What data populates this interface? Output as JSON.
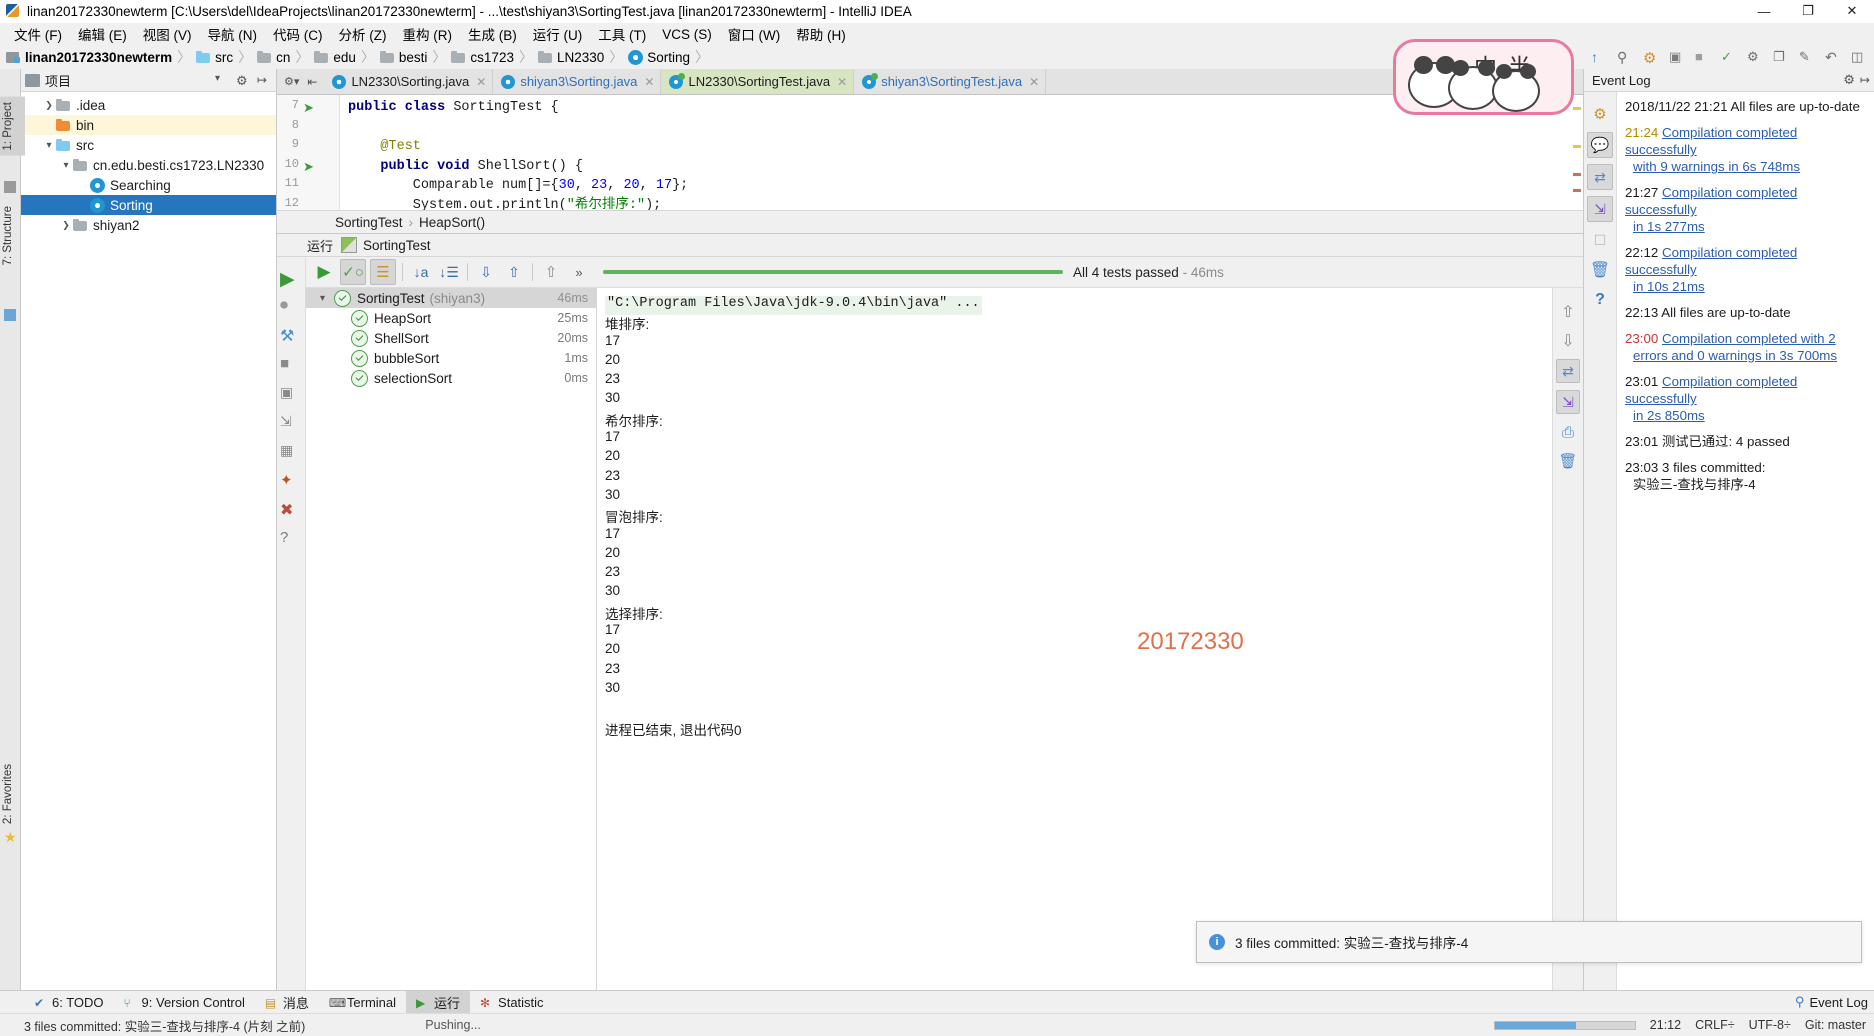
{
  "window": {
    "title": "linan20172330newterm [C:\\Users\\del\\IdeaProjects\\linan20172330newterm] - ...\\test\\shiyan3\\SortingTest.java [linan20172330newterm] - IntelliJ IDEA",
    "minimize": "—",
    "maximize": "❐",
    "close": "✕"
  },
  "menu": [
    {
      "label": "文件 (F)"
    },
    {
      "label": "编辑 (E)"
    },
    {
      "label": "视图 (V)"
    },
    {
      "label": "导航 (N)"
    },
    {
      "label": "代码 (C)"
    },
    {
      "label": "分析 (Z)"
    },
    {
      "label": "重构 (R)"
    },
    {
      "label": "生成 (B)"
    },
    {
      "label": "运行 (U)"
    },
    {
      "label": "工具 (T)"
    },
    {
      "label": "VCS (S)"
    },
    {
      "label": "窗口 (W)"
    },
    {
      "label": "帮助 (H)"
    }
  ],
  "breadcrumb": [
    {
      "label": "linan20172330newterm",
      "icon": "project-icon"
    },
    {
      "label": "src",
      "icon": "folder-blue-icon"
    },
    {
      "label": "cn",
      "icon": "folder-icon"
    },
    {
      "label": "edu",
      "icon": "folder-icon"
    },
    {
      "label": "besti",
      "icon": "folder-icon"
    },
    {
      "label": "cs1723",
      "icon": "folder-icon"
    },
    {
      "label": "LN2330",
      "icon": "folder-icon"
    },
    {
      "label": "Sorting",
      "icon": "class-icon"
    }
  ],
  "panda": {
    "char1": "中",
    "char2": "半"
  },
  "left_rail": [
    {
      "label": "1: Project",
      "selected": true
    },
    {
      "label": "7: Structure",
      "selected": false
    },
    {
      "label": "2: Favorites",
      "selected": false
    }
  ],
  "project_panel": {
    "title": "项目",
    "tree": [
      {
        "label": ".idea",
        "icon": "folder-icon",
        "arrow": "right",
        "indent": 1,
        "state": "normal"
      },
      {
        "label": "bin",
        "icon": "folder-orange-icon",
        "arrow": "none",
        "indent": 1,
        "state": "highlight"
      },
      {
        "label": "src",
        "icon": "folder-blue-icon",
        "arrow": "down",
        "indent": 1,
        "state": "normal"
      },
      {
        "label": "cn.edu.besti.cs1723.LN2330",
        "icon": "folder-icon",
        "arrow": "down",
        "indent": 2,
        "state": "normal"
      },
      {
        "label": "Searching",
        "icon": "class-icon",
        "arrow": "none",
        "indent": 3,
        "state": "normal"
      },
      {
        "label": "Sorting",
        "icon": "class-icon",
        "arrow": "none",
        "indent": 3,
        "state": "selected"
      },
      {
        "label": "shiyan2",
        "icon": "folder-icon",
        "arrow": "right",
        "indent": 2,
        "state": "normal"
      }
    ]
  },
  "editor_tabs": [
    {
      "label": "LN2330\\Sorting.java",
      "active": false,
      "color": "normal",
      "icon": "class-icon"
    },
    {
      "label": "shiyan3\\Sorting.java",
      "active": false,
      "color": "blue",
      "icon": "class-icon"
    },
    {
      "label": "LN2330\\SortingTest.java",
      "active": true,
      "color": "normal",
      "icon": "test-class-icon"
    },
    {
      "label": "shiyan3\\SortingTest.java",
      "active": false,
      "color": "blue",
      "icon": "test-class-icon"
    }
  ],
  "editor": {
    "lines": [
      {
        "num": "7",
        "html": "<span class='kw'>public class</span> SortingTest {",
        "marker": "run-gutter-icon"
      },
      {
        "num": "8",
        "html": "",
        "marker": ""
      },
      {
        "num": "9",
        "html": "    <span class='ann'>@Test</span>",
        "marker": ""
      },
      {
        "num": "10",
        "html": "    <span class='kw'>public void</span> ShellSort() {",
        "marker": "run-gutter-icon"
      },
      {
        "num": "11",
        "html": "        Comparable num[]={<span class='num'>30</span>, <span class='num'>23</span>, <span class='num'>20</span>, <span class='num'>17</span>};",
        "marker": ""
      },
      {
        "num": "12",
        "html": "        System.out.println(<span class='str'>\"希尔排序:\"</span>);",
        "marker": ""
      }
    ],
    "breadcrumb": [
      "SortingTest",
      "HeapSort()"
    ]
  },
  "run_window": {
    "header_label": "运行",
    "config_name": "SortingTest",
    "status": "All 4 tests passed",
    "status_time": "- 46ms",
    "toolbar_icons": [
      "rerun-icon",
      "toggle-passed-icon",
      "show-ignored-icon",
      "sort-alphabetically-icon",
      "sort-by-duration-icon",
      "expand-all-icon",
      "collapse-all-icon",
      "prev-failed-icon",
      "more-icon"
    ],
    "tests": [
      {
        "name": "SortingTest",
        "suffix": "(shiyan3)",
        "time": "46ms",
        "root": true
      },
      {
        "name": "HeapSort",
        "suffix": "",
        "time": "25ms",
        "root": false
      },
      {
        "name": "ShellSort",
        "suffix": "",
        "time": "20ms",
        "root": false
      },
      {
        "name": "bubbleSort",
        "suffix": "",
        "time": "1ms",
        "root": false
      },
      {
        "name": "selectionSort",
        "suffix": "",
        "time": "0ms",
        "root": false
      }
    ],
    "console": [
      {
        "text": "\"C:\\Program Files\\Java\\jdk-9.0.4\\bin\\java\" ...",
        "style": "cmd"
      },
      {
        "text": "堆排序:",
        "style": "plain"
      },
      {
        "text": "17",
        "style": "plain"
      },
      {
        "text": "20",
        "style": "plain"
      },
      {
        "text": "23",
        "style": "plain"
      },
      {
        "text": "30",
        "style": "plain"
      },
      {
        "text": "希尔排序:",
        "style": "plain"
      },
      {
        "text": "17",
        "style": "plain"
      },
      {
        "text": "20",
        "style": "plain"
      },
      {
        "text": "23",
        "style": "plain"
      },
      {
        "text": "30",
        "style": "plain"
      },
      {
        "text": "冒泡排序:",
        "style": "plain"
      },
      {
        "text": "17",
        "style": "plain"
      },
      {
        "text": "20",
        "style": "plain"
      },
      {
        "text": "23",
        "style": "plain"
      },
      {
        "text": "30",
        "style": "plain"
      },
      {
        "text": "选择排序:",
        "style": "plain"
      },
      {
        "text": "17",
        "style": "plain"
      },
      {
        "text": "20",
        "style": "plain"
      },
      {
        "text": "23",
        "style": "plain"
      },
      {
        "text": "30",
        "style": "plain"
      },
      {
        "text": "",
        "style": "plain"
      },
      {
        "text": "进程已结束, 退出代码0",
        "style": "plain"
      }
    ],
    "watermark": "20172330"
  },
  "event_log": {
    "title": "Event Log",
    "entries": [
      {
        "time": "2018/11/22",
        "time_style": "plain",
        "lines": [
          {
            "text": "21:21  All files are up-to-date",
            "style": "plain"
          }
        ]
      },
      {
        "time": "21:24",
        "time_style": "warn",
        "lines": [
          {
            "text": "Compilation completed successfully",
            "style": "link"
          },
          {
            "text": "with 9 warnings in 6s 748ms",
            "style": "link"
          }
        ]
      },
      {
        "time": "21:27",
        "time_style": "plain",
        "lines": [
          {
            "text": "Compilation completed successfully",
            "style": "link"
          },
          {
            "text": "in 1s 277ms",
            "style": "link"
          }
        ]
      },
      {
        "time": "22:12",
        "time_style": "plain",
        "lines": [
          {
            "text": "Compilation completed successfully",
            "style": "link"
          },
          {
            "text": "in 10s 21ms",
            "style": "link"
          }
        ]
      },
      {
        "time": "22:13",
        "time_style": "plain",
        "lines": [
          {
            "text": "All files are up-to-date",
            "style": "plain"
          }
        ]
      },
      {
        "time": "23:00",
        "time_style": "err",
        "lines": [
          {
            "text": "Compilation completed with 2",
            "style": "link"
          },
          {
            "text": "errors and 0 warnings in 3s 700ms",
            "style": "link"
          }
        ]
      },
      {
        "time": "23:01",
        "time_style": "plain",
        "lines": [
          {
            "text": "Compilation completed successfully",
            "style": "link"
          },
          {
            "text": "in 2s 850ms",
            "style": "link"
          }
        ]
      },
      {
        "time": "23:01",
        "time_style": "plain",
        "lines": [
          {
            "text": "测试已通过: 4 passed",
            "style": "plain"
          }
        ]
      },
      {
        "time": "23:03",
        "time_style": "plain",
        "lines": [
          {
            "text": "3 files committed:",
            "style": "plain"
          },
          {
            "text": "实验三-查找与排序-4",
            "style": "plain"
          }
        ]
      }
    ]
  },
  "balloon": {
    "text": "3 files committed: 实验三-查找与排序-4",
    "icon": "info-icon"
  },
  "bottom_tabs": [
    {
      "label": "6: TODO",
      "selected": false,
      "icon": "todo-icon"
    },
    {
      "label": "9: Version Control",
      "selected": false,
      "icon": "vcs-icon"
    },
    {
      "label": "消息",
      "selected": false,
      "icon": "messages-icon"
    },
    {
      "label": "Terminal",
      "selected": false,
      "icon": "terminal-icon"
    },
    {
      "label": "运行",
      "selected": true,
      "icon": "run-icon"
    },
    {
      "label": "Statistic",
      "selected": false,
      "icon": "statistic-icon"
    }
  ],
  "bottom_right_label": "Event Log",
  "status_bar": {
    "message": "3 files committed: 实验三-查找与排序-4 (片刻 之前)",
    "progress_label": "Pushing...",
    "time": "21:12",
    "line_sep": "CRLF÷",
    "encoding": "UTF-8÷",
    "git": "Git: master"
  }
}
